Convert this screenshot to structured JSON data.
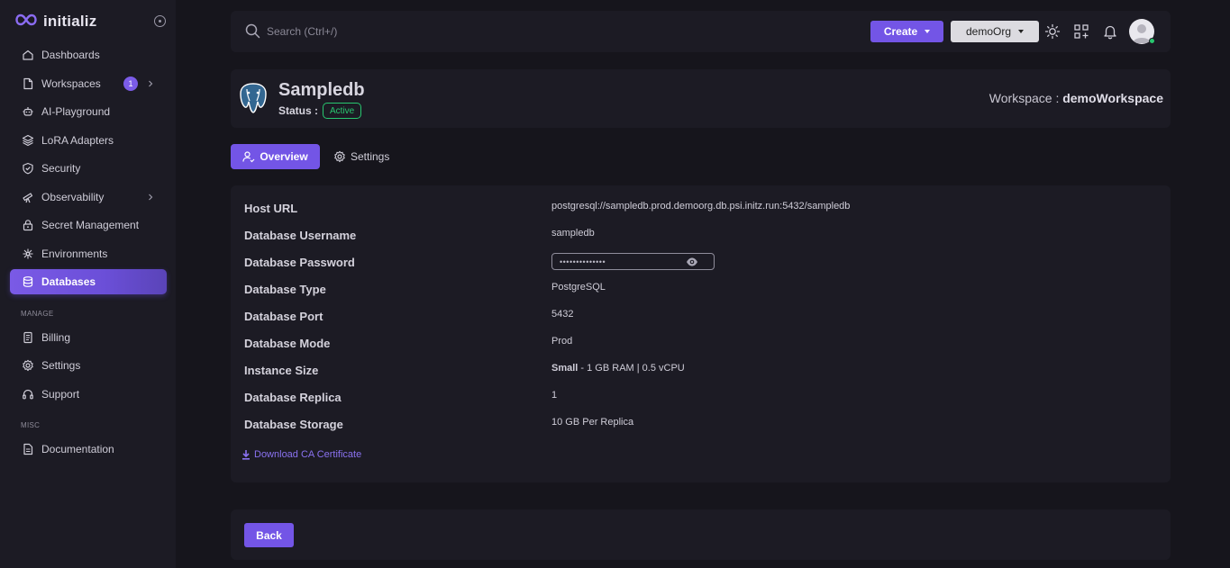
{
  "brand": {
    "name": "initializ",
    "logo_icon": "infinity-icon"
  },
  "sidebar": {
    "items": [
      {
        "label": "Dashboards",
        "icon": "home-icon"
      },
      {
        "label": "Workspaces",
        "icon": "file-icon",
        "badge": "1"
      },
      {
        "label": "AI-Playground",
        "icon": "robot-icon"
      },
      {
        "label": "LoRA Adapters",
        "icon": "layers-icon"
      },
      {
        "label": "Security",
        "icon": "shield-icon"
      },
      {
        "label": "Observability",
        "icon": "telescope-icon"
      },
      {
        "label": "Secret Management",
        "icon": "lock-icon"
      },
      {
        "label": "Environments",
        "icon": "network-icon"
      },
      {
        "label": "Databases",
        "icon": "database-icon",
        "active": true
      }
    ],
    "manage_label": "MANAGE",
    "manage_items": [
      {
        "label": "Billing",
        "icon": "receipt-icon"
      },
      {
        "label": "Settings",
        "icon": "gear-icon"
      },
      {
        "label": "Support",
        "icon": "headset-icon"
      }
    ],
    "misc_label": "MISC",
    "misc_items": [
      {
        "label": "Documentation",
        "icon": "document-icon"
      }
    ]
  },
  "topbar": {
    "search_placeholder": "Search (Ctrl+/)",
    "create_label": "Create",
    "org_label": "demoOrg"
  },
  "header": {
    "db_name": "Sampledb",
    "status_label": "Status :",
    "status_value": "Active",
    "workspace_label": "Workspace :",
    "workspace_value": "demoWorkspace"
  },
  "tabs": {
    "overview": "Overview",
    "settings": "Settings"
  },
  "details": [
    {
      "label": "Host URL",
      "value": "postgresql://sampledb.prod.demoorg.db.psi.initz.run:5432/sampledb"
    },
    {
      "label": "Database Username",
      "value": "sampledb"
    },
    {
      "label": "Database Password",
      "value": "••••••••••••••"
    },
    {
      "label": "Database Type",
      "value": "PostgreSQL"
    },
    {
      "label": "Database Port",
      "value": "5432"
    },
    {
      "label": "Database Mode",
      "value": "Prod"
    },
    {
      "label": "Instance Size",
      "value_bold": "Small",
      "value": " - 1 GB RAM | 0.5 vCPU"
    },
    {
      "label": "Database Replica",
      "value": "1"
    },
    {
      "label": "Database Storage",
      "value": "10 GB Per Replica"
    }
  ],
  "download_label": "Download CA Certificate",
  "back_label": "Back",
  "colors": {
    "accent": "#7355e6",
    "active_status": "#28c76f",
    "background": "#16151c",
    "card": "#1c1b24"
  }
}
